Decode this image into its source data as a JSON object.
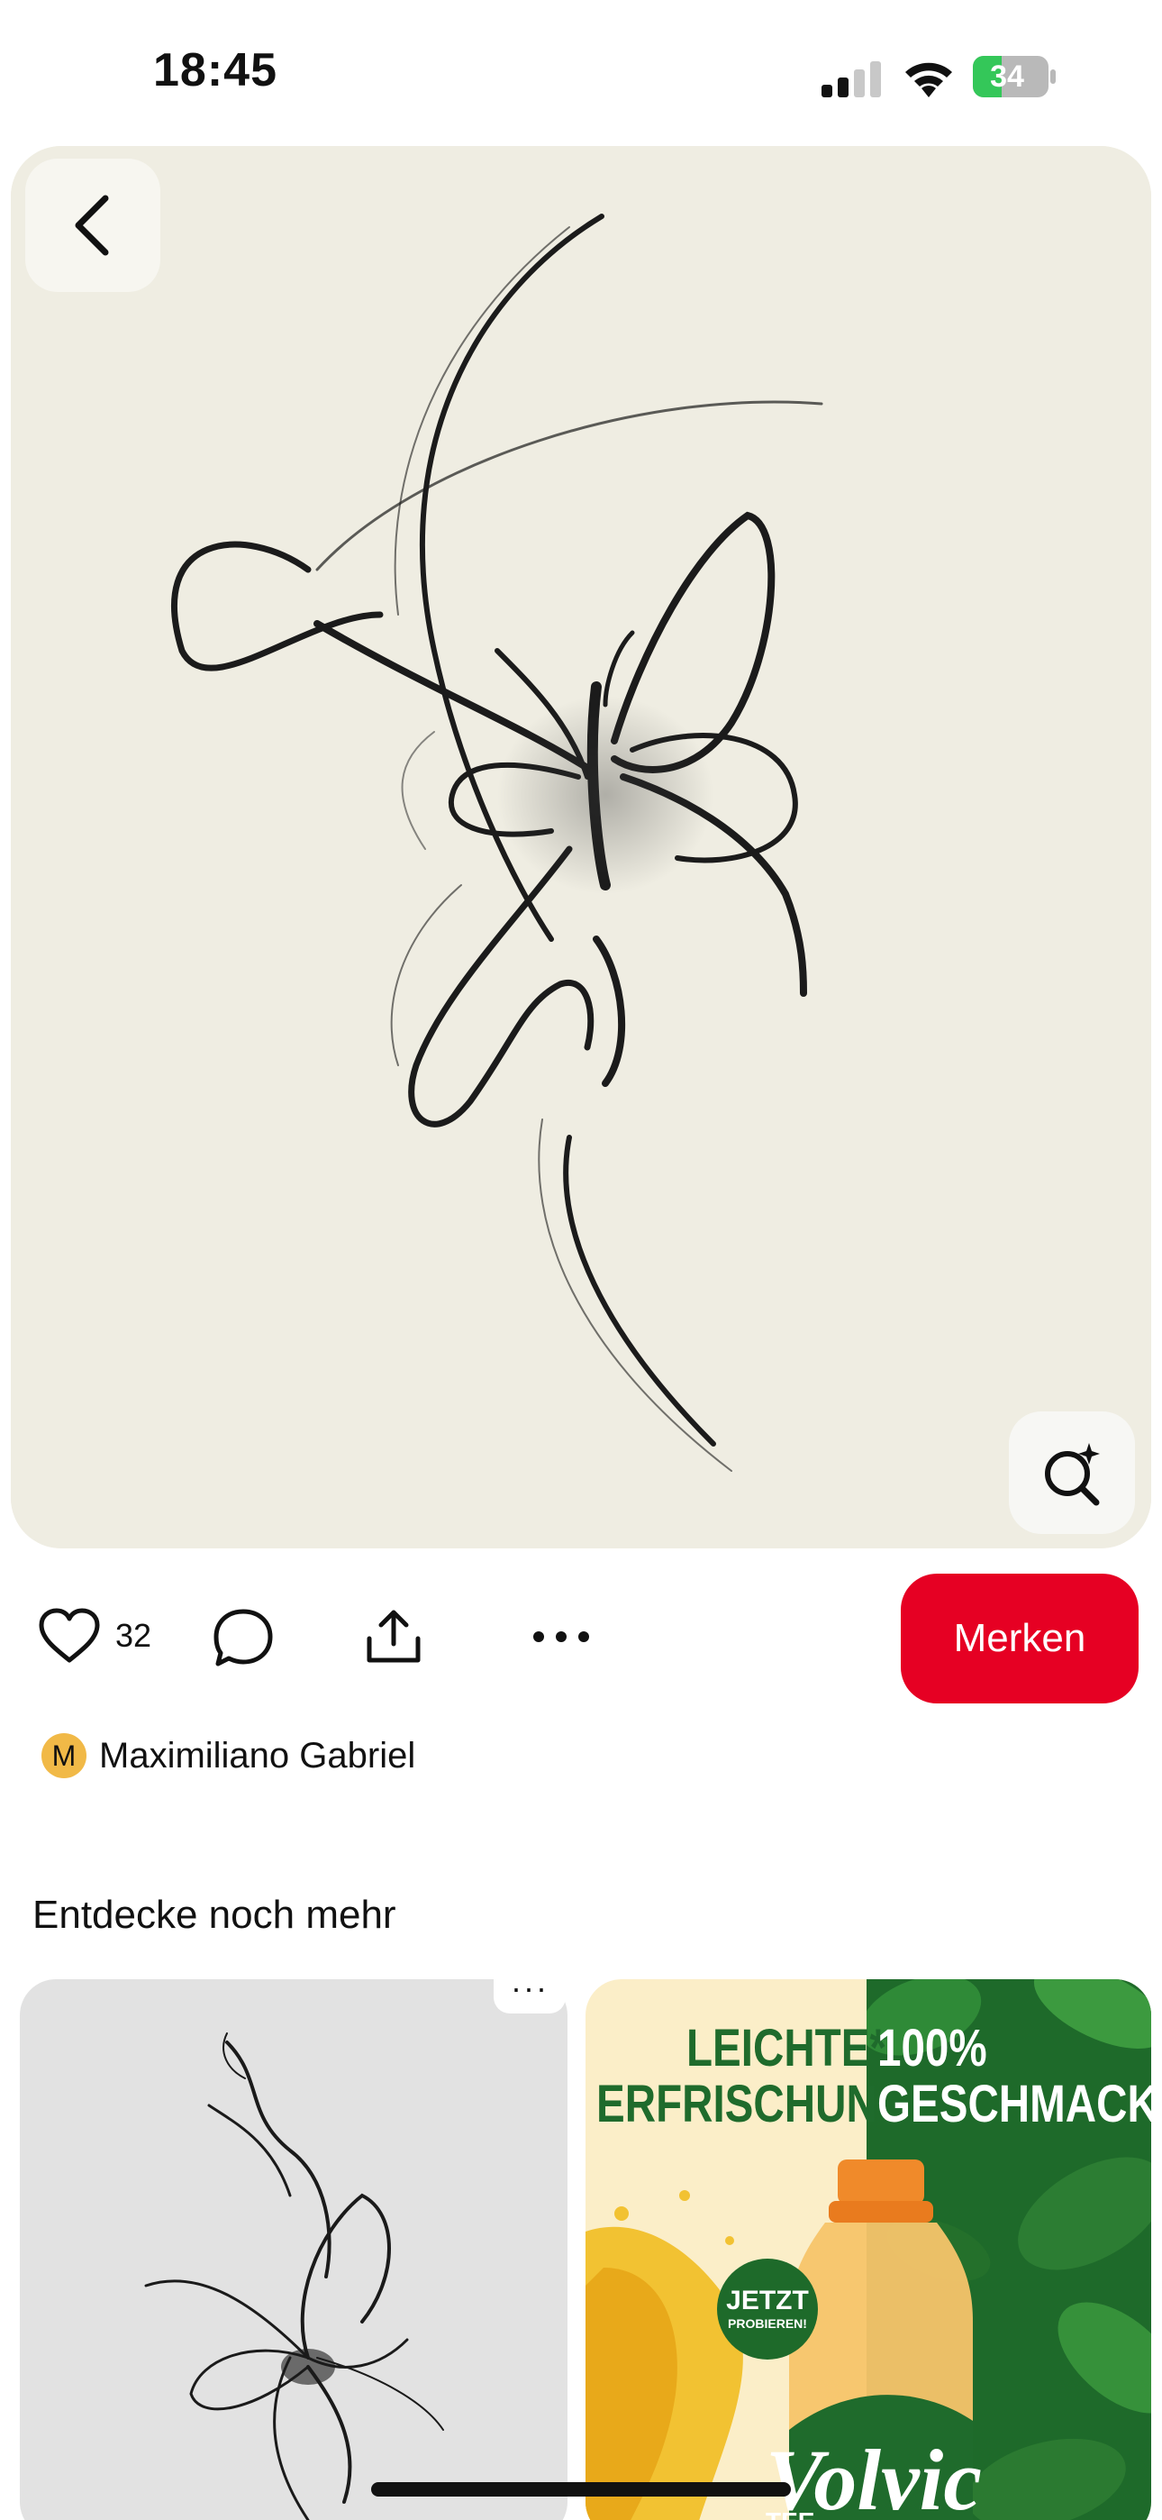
{
  "status_bar": {
    "time": "18:45",
    "battery_level": "34",
    "battery_charging": true,
    "signal_icon": "cellular-signal-icon",
    "wifi_icon": "wifi-icon",
    "battery_icon": "battery-charging-icon"
  },
  "pin": {
    "image_description_icon": "butterfly-line-art",
    "back_icon": "chevron-left-icon",
    "lens_icon": "visual-search-icon"
  },
  "actions": {
    "like_icon": "heart-icon",
    "like_count": "32",
    "comment_icon": "comment-bubble-icon",
    "share_icon": "share-upload-icon",
    "more_icon": "more-dots-icon",
    "save_label": "Merken",
    "save_color": "#e60023"
  },
  "creator": {
    "avatar_initial": "M",
    "name": "Maximiliano Gabriel",
    "avatar_color": "#f1b947"
  },
  "more_section": {
    "title": "Entdecke noch mehr",
    "card_menu": "···",
    "ad": {
      "headline_left_1": "LEICHTE*",
      "headline_left_2": "ERFRISCHUNG",
      "headline_right_1": "100%",
      "headline_right_2": "GESCHMACK",
      "badge_line_1": "JETZT",
      "badge_line_2": "PROBIEREN!",
      "brand": "Volvic",
      "product": "TEE"
    }
  }
}
